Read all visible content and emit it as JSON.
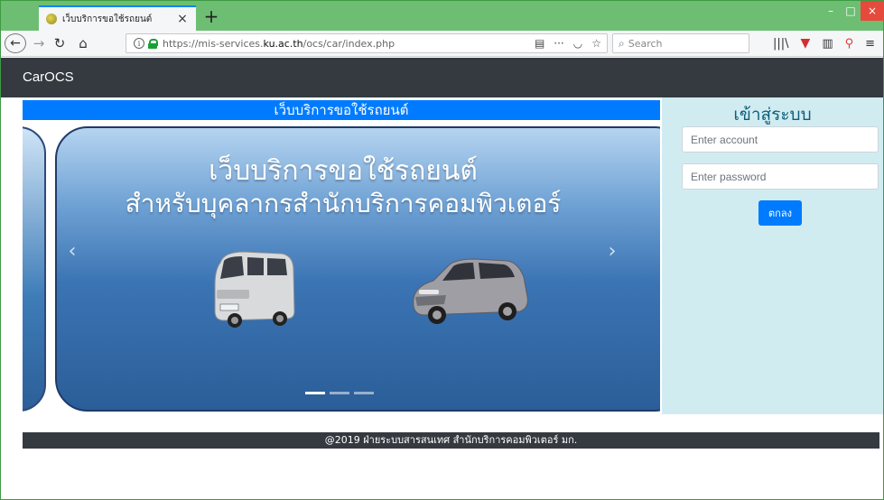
{
  "browser": {
    "tab_title": "เว็บบริการขอใช้รถยนต์",
    "tab_close": "×",
    "new_tab": "+",
    "url_prefix": "https://mis-services.",
    "url_host": "ku.ac.th",
    "url_path": "/ocs/car/index.php",
    "search_placeholder": "Search",
    "url_more": "···"
  },
  "site": {
    "brand": "CarOCS",
    "service_title": "เว็บบริการขอใช้รถยนต์"
  },
  "carousel": {
    "line1": "เว็บบริการขอใช้รถยนต์",
    "line2": "สำหรับบุคลากรสำนักบริการคอมพิวเตอร์",
    "prev": "‹",
    "next": "›",
    "slide_count": 3,
    "active_index": 0
  },
  "login": {
    "title": "เข้าสู่ระบบ",
    "account_placeholder": "Enter account",
    "password_placeholder": "Enter password",
    "submit_label": "ตกลง"
  },
  "footer": {
    "text": "@2019 ฝ่ายระบบสารสนเทศ สำนักบริการคอมพิวเตอร์ มก."
  },
  "colors": {
    "primary": "#007bff",
    "navbar": "#343a40",
    "login_bg": "#d1ecf1",
    "window_frame": "#6dbe73"
  }
}
